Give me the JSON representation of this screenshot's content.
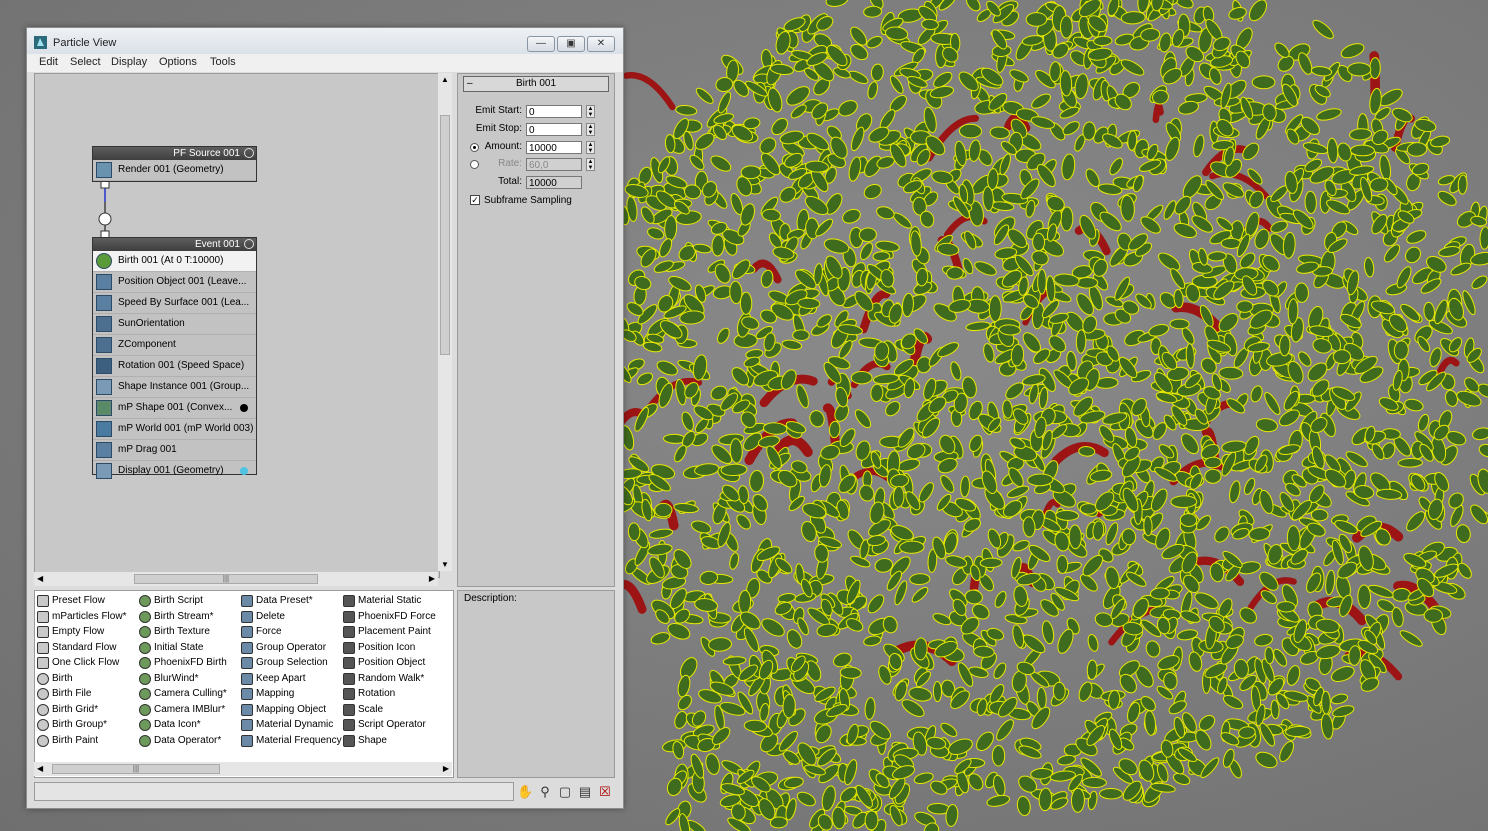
{
  "window": {
    "title": "Particle View"
  },
  "menu": [
    "Edit",
    "Select",
    "Display",
    "Options",
    "Tools"
  ],
  "graph": {
    "source_node": {
      "title": "PF Source 001",
      "items": [
        "Render 001 (Geometry)"
      ]
    },
    "event_node": {
      "title": "Event 001",
      "items": [
        "Birth 001 (At 0 T:10000)",
        "Position Object 001 (Leave...",
        "Speed By Surface 001 (Lea...",
        "SunOrientation",
        "ZComponent",
        "Rotation 001 (Speed Space)",
        "Shape Instance 001 (Group...",
        "mP Shape 001 (Convex...",
        "mP World 001 (mP World 003)",
        "mP Drag 001",
        "Display 001 (Geometry)"
      ]
    }
  },
  "params": {
    "rollout_title": "Birth 001",
    "emit_start_label": "Emit Start:",
    "emit_start_value": "0",
    "emit_stop_label": "Emit Stop:",
    "emit_stop_value": "0",
    "amount_label": "Amount:",
    "amount_value": "10000",
    "rate_label": "Rate:",
    "rate_value": "60,0",
    "total_label": "Total:",
    "total_value": "10000",
    "subframe_label": "Subframe Sampling"
  },
  "depot": {
    "col1": [
      "Preset Flow",
      "mParticles Flow*",
      "Empty Flow",
      "Standard Flow",
      "One Click Flow",
      "Birth",
      "Birth File",
      "Birth Grid*",
      "Birth Group*",
      "Birth Paint"
    ],
    "col2": [
      "Birth Script",
      "Birth Stream*",
      "Birth Texture",
      "Initial State",
      "PhoenixFD Birth",
      "BlurWind*",
      "Camera Culling*",
      "Camera IMBlur*",
      "Data Icon*",
      "Data Operator*"
    ],
    "col3": [
      "Data Preset*",
      "Delete",
      "Force",
      "Group Operator",
      "Group Selection",
      "Keep Apart",
      "Mapping",
      "Mapping Object",
      "Material Dynamic",
      "Material Frequency"
    ],
    "col4": [
      "Material Static",
      "PhoenixFD Force",
      "Placement Paint",
      "Position Icon",
      "Position Object",
      "Random Walk*",
      "Rotation",
      "Scale",
      "Script Operator",
      "Shape"
    ]
  },
  "description": {
    "label": "Description:"
  },
  "colors": {
    "leaf_wire": "#e8e800",
    "leaf_fill": "#3f6b1e",
    "stem": "#9c1414",
    "background": "#7a7a7a"
  },
  "icons": [
    "app-icon",
    "minimize-icon",
    "maximize-icon",
    "close-icon",
    "pan-hand-icon",
    "zoom-icon",
    "zoom-region-icon",
    "zoom-extents-icon",
    "no-draw-icon"
  ]
}
